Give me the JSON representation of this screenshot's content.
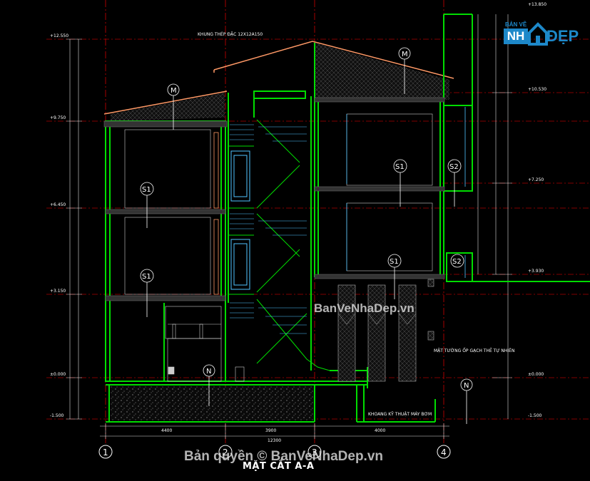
{
  "drawing": {
    "title": "MẶT CẮT A-A",
    "steel_frame_note": "KHUNG THÉP ĐẶC 12X12A150",
    "wall_tile_note": "MẶT TƯỜNG ỐP GẠCH THẺ TỰ NHIÊN",
    "pump_note": "KHOANG KỸ THUẬT MÁY BƠM",
    "room_tags": [
      "M",
      "M",
      "S1",
      "S1",
      "S1",
      "S1",
      "S2",
      "S2",
      "N",
      "N"
    ],
    "grid_axes": [
      "1",
      "2",
      "3",
      "4"
    ],
    "levels_left": [
      "+12.550",
      "+9.750",
      "+6.450",
      "+3.150",
      "±0.000",
      "-1.500"
    ],
    "levels_right": [
      "+13.850",
      "+10.530",
      "+7.250",
      "+3.930",
      "±0.000",
      "-1.500"
    ],
    "dims_bottom": [
      "4400",
      "3900",
      "4000"
    ],
    "dim_total": "12300"
  },
  "watermark": {
    "center": "BanVeNhaDep.vn",
    "bottom": "Bản quyền © BanVeNhaDep.vn"
  },
  "logo": {
    "top": "BẢN VẼ",
    "nh": "NH",
    "dep": "ĐẸP"
  },
  "colors": {
    "wall": "#00dd00",
    "roof": "#ff9966",
    "grid": "#cc0000",
    "dim": "#ffffff",
    "glazing": "#00aaff"
  }
}
